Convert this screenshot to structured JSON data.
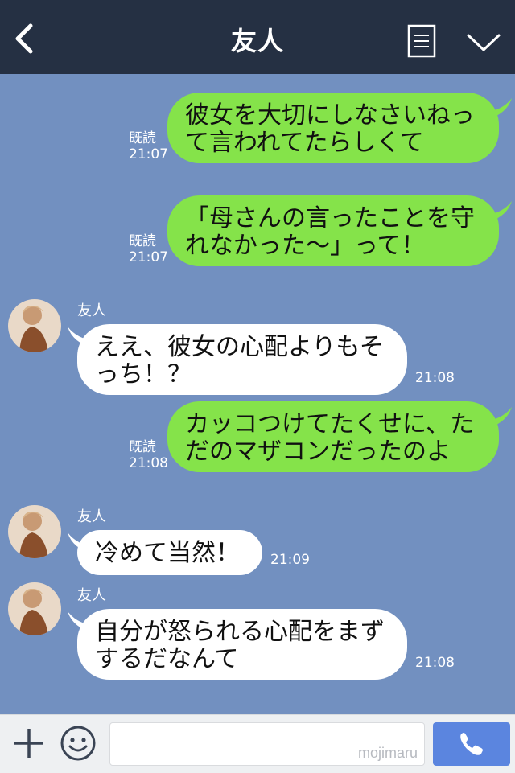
{
  "header": {
    "title": "友人"
  },
  "messages": [
    {
      "dir": "out",
      "text": "彼女を大切にしなさいねっ\nて言われてたらしくて",
      "status": "既読",
      "time": "21:07"
    },
    {
      "dir": "out",
      "text": "「母さんの言ったことを守\nれなかった〜」って！",
      "status": "既読",
      "time": "21:07"
    },
    {
      "dir": "in",
      "sender": "友人",
      "text": "ええ、彼女の心配よりもそ\nっち！？",
      "time": "21:08"
    },
    {
      "dir": "out",
      "text": "カッコつけてたくせに、た\nだのマザコンだったのよ",
      "status": "既読",
      "time": "21:08"
    },
    {
      "dir": "in",
      "sender": "友人",
      "text": "冷めて当然！",
      "time": "21:09"
    },
    {
      "dir": "in",
      "sender": "友人",
      "text": "自分が怒られる心配をまず\nするだなんて",
      "time": "21:08"
    }
  ],
  "input": {
    "watermark": "mojimaru"
  },
  "icons": {
    "back": "chevron-left-icon",
    "memo": "note-icon",
    "menu": "chevron-down-icon",
    "add": "plus-icon",
    "emoji": "smiley-icon",
    "call": "phone-icon"
  },
  "colors": {
    "header_bg": "#253043",
    "chat_bg": "#7290c0",
    "outgoing_bubble": "#85e34a",
    "incoming_bubble": "#ffffff",
    "call_button": "#5b85df"
  }
}
